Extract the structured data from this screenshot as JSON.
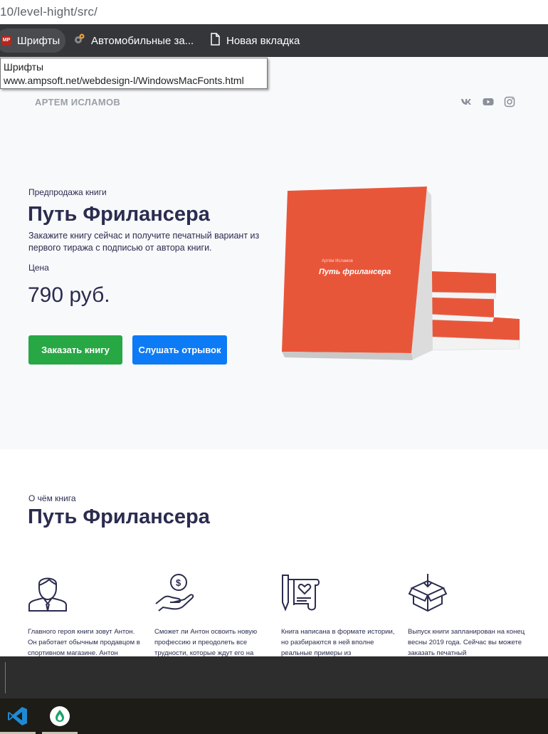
{
  "browser": {
    "address": "10/level-hight/src/",
    "bookmarks": [
      {
        "label": "Шрифты",
        "icon": "mp-favicon"
      },
      {
        "label": "Автомобильные за...",
        "icon": "gear-favicon"
      },
      {
        "label": "Новая вкладка",
        "icon": "page-icon"
      }
    ],
    "tooltip": {
      "title": "Шрифты",
      "url": "www.ampsoft.net/webdesign-l/WindowsMacFonts.html"
    }
  },
  "site": {
    "brand": "АРТЕМ ИСЛАМОВ",
    "social": [
      "vk-icon",
      "youtube-icon",
      "instagram-icon"
    ],
    "hero": {
      "pre": "Предпродажа книги",
      "title": "Путь Фрилансера",
      "description": "Закажите книгу сейчас и получите печатный вариант из первого тиража с подписью от автора книги.",
      "price_label": "Цена",
      "price": "790 руб.",
      "order_button": "Заказать книгу",
      "listen_button": "Слушать отрывок",
      "book_author": "Артём Исламов",
      "book_title": "Путь фрилансера"
    },
    "about": {
      "pre": "О чём книга",
      "title": "Путь Фрилансера",
      "features": [
        {
          "icon": "person-icon",
          "text": "Главного героя книги зовут Антон. Он работает обычным продавцом в спортивном магазине. Антон"
        },
        {
          "icon": "money-hand-icon",
          "text": "Сможет ли Антон освоить новую профессию и преодолеть все трудности, которые ждут его на"
        },
        {
          "icon": "scroll-icon",
          "text": "Книга написана в формате истории, но разбираются в ней вполне реальные примеры из"
        },
        {
          "icon": "box-icon",
          "text": "Выпуск книги запланирован на конец весны 2019 года. Сейчас вы можете заказать печатный"
        }
      ]
    }
  },
  "taskbar": {
    "apps": [
      "vscode-icon",
      "droplet-app-icon"
    ]
  },
  "colors": {
    "accent_dark": "#2b2c4f",
    "green": "#28a745",
    "blue": "#0d7bf5",
    "book_orange": "#e8563a"
  }
}
